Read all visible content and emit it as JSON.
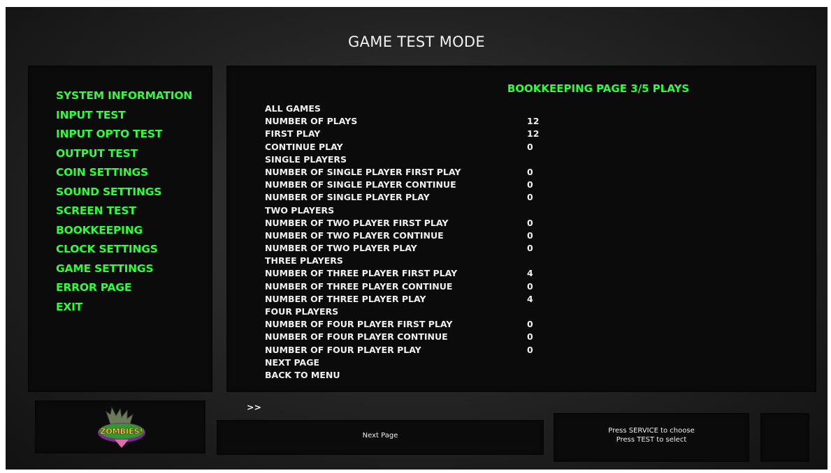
{
  "header": {
    "title": "GAME TEST MODE"
  },
  "menu": {
    "items": [
      {
        "label": "SYSTEM INFORMATION"
      },
      {
        "label": "INPUT TEST"
      },
      {
        "label": "INPUT OPTO TEST"
      },
      {
        "label": "OUTPUT TEST"
      },
      {
        "label": "COIN SETTINGS"
      },
      {
        "label": "SOUND SETTINGS"
      },
      {
        "label": "SCREEN TEST"
      },
      {
        "label": "BOOKKEEPING"
      },
      {
        "label": "CLOCK SETTINGS"
      },
      {
        "label": "GAME SETTINGS"
      },
      {
        "label": "ERROR PAGE"
      },
      {
        "label": "EXIT"
      }
    ]
  },
  "content": {
    "heading": "BOOKKEEPING PAGE 3/5 PLAYS",
    "cursor": ">>",
    "rows": [
      {
        "label": "ALL GAMES",
        "value": ""
      },
      {
        "label": "NUMBER OF PLAYS",
        "value": "12"
      },
      {
        "label": "FIRST PLAY",
        "value": "12"
      },
      {
        "label": "CONTINUE PLAY",
        "value": "0"
      },
      {
        "label": "SINGLE PLAYERS",
        "value": ""
      },
      {
        "label": "NUMBER OF SINGLE PLAYER FIRST PLAY",
        "value": "0"
      },
      {
        "label": "NUMBER OF SINGLE PLAYER CONTINUE",
        "value": "0"
      },
      {
        "label": "NUMBER OF SINGLE PLAYER PLAY",
        "value": "0"
      },
      {
        "label": "TWO PLAYERS",
        "value": ""
      },
      {
        "label": "NUMBER OF TWO PLAYER FIRST PLAY",
        "value": "0"
      },
      {
        "label": "NUMBER OF TWO PLAYER CONTINUE",
        "value": "0"
      },
      {
        "label": "NUMBER OF TWO PLAYER PLAY",
        "value": "0"
      },
      {
        "label": "THREE PLAYERS",
        "value": ""
      },
      {
        "label": "NUMBER OF THREE PLAYER FIRST PLAY",
        "value": "4"
      },
      {
        "label": "NUMBER OF THREE PLAYER CONTINUE",
        "value": "0"
      },
      {
        "label": "NUMBER OF THREE PLAYER PLAY",
        "value": "4"
      },
      {
        "label": "FOUR PLAYERS",
        "value": ""
      },
      {
        "label": "NUMBER OF FOUR PLAYER FIRST PLAY",
        "value": "0"
      },
      {
        "label": "NUMBER OF FOUR PLAYER CONTINUE",
        "value": "0"
      },
      {
        "label": "NUMBER OF FOUR PLAYER PLAY",
        "value": "0"
      },
      {
        "label": "NEXT PAGE",
        "value": ""
      },
      {
        "label": "BACK TO MENU",
        "value": ""
      }
    ]
  },
  "footer": {
    "hint": "Next Page",
    "instructions": [
      "Press SERVICE to choose",
      "Press TEST to select"
    ],
    "logo_text": "ZOMBIES!",
    "logo_icon": "zombies-logo"
  },
  "colors": {
    "accent": "#2cff3a",
    "text": "#f0f0f0",
    "panel": "#0b0b0b"
  }
}
